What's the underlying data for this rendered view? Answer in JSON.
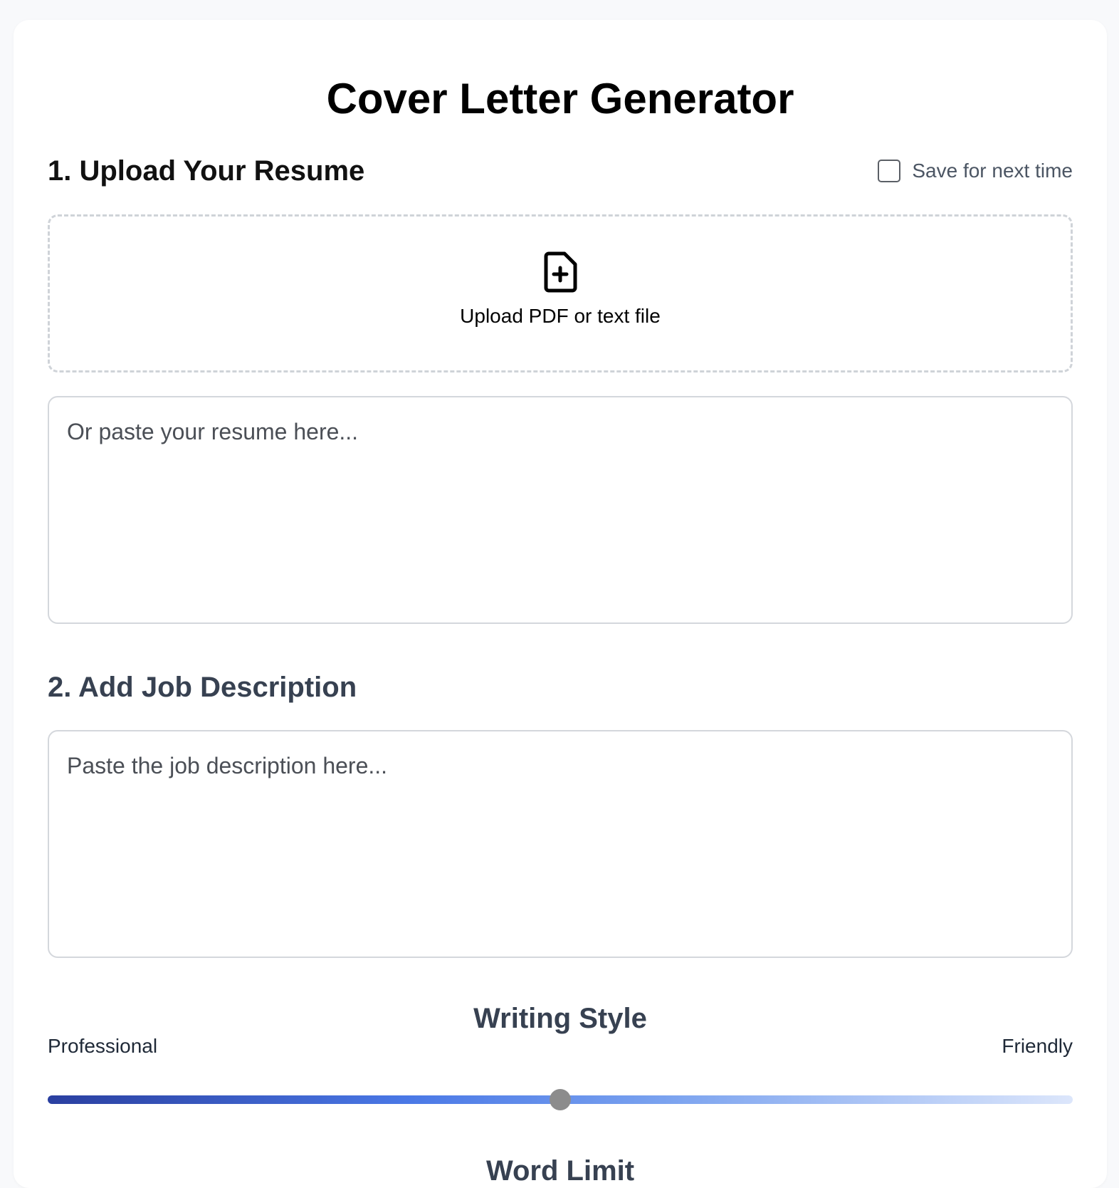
{
  "page": {
    "title": "Cover Letter Generator"
  },
  "resume_section": {
    "title": "1. Upload Your Resume",
    "save_label": "Save for next time",
    "save_checked": false,
    "upload_icon": "file-plus-icon",
    "upload_label": "Upload PDF or text file",
    "textarea_value": "",
    "textarea_placeholder": "Or paste your resume here..."
  },
  "job_section": {
    "title": "2. Add Job Description",
    "textarea_value": "",
    "textarea_placeholder": "Paste the job description here..."
  },
  "writing_style": {
    "title": "Writing Style",
    "left_label": "Professional",
    "right_label": "Friendly",
    "value": 0.5,
    "colors": {
      "track_start": "#2a3fa0",
      "track_end": "#dce6fb",
      "thumb": "#8c8c8c"
    }
  },
  "word_limit": {
    "title": "Word Limit"
  }
}
